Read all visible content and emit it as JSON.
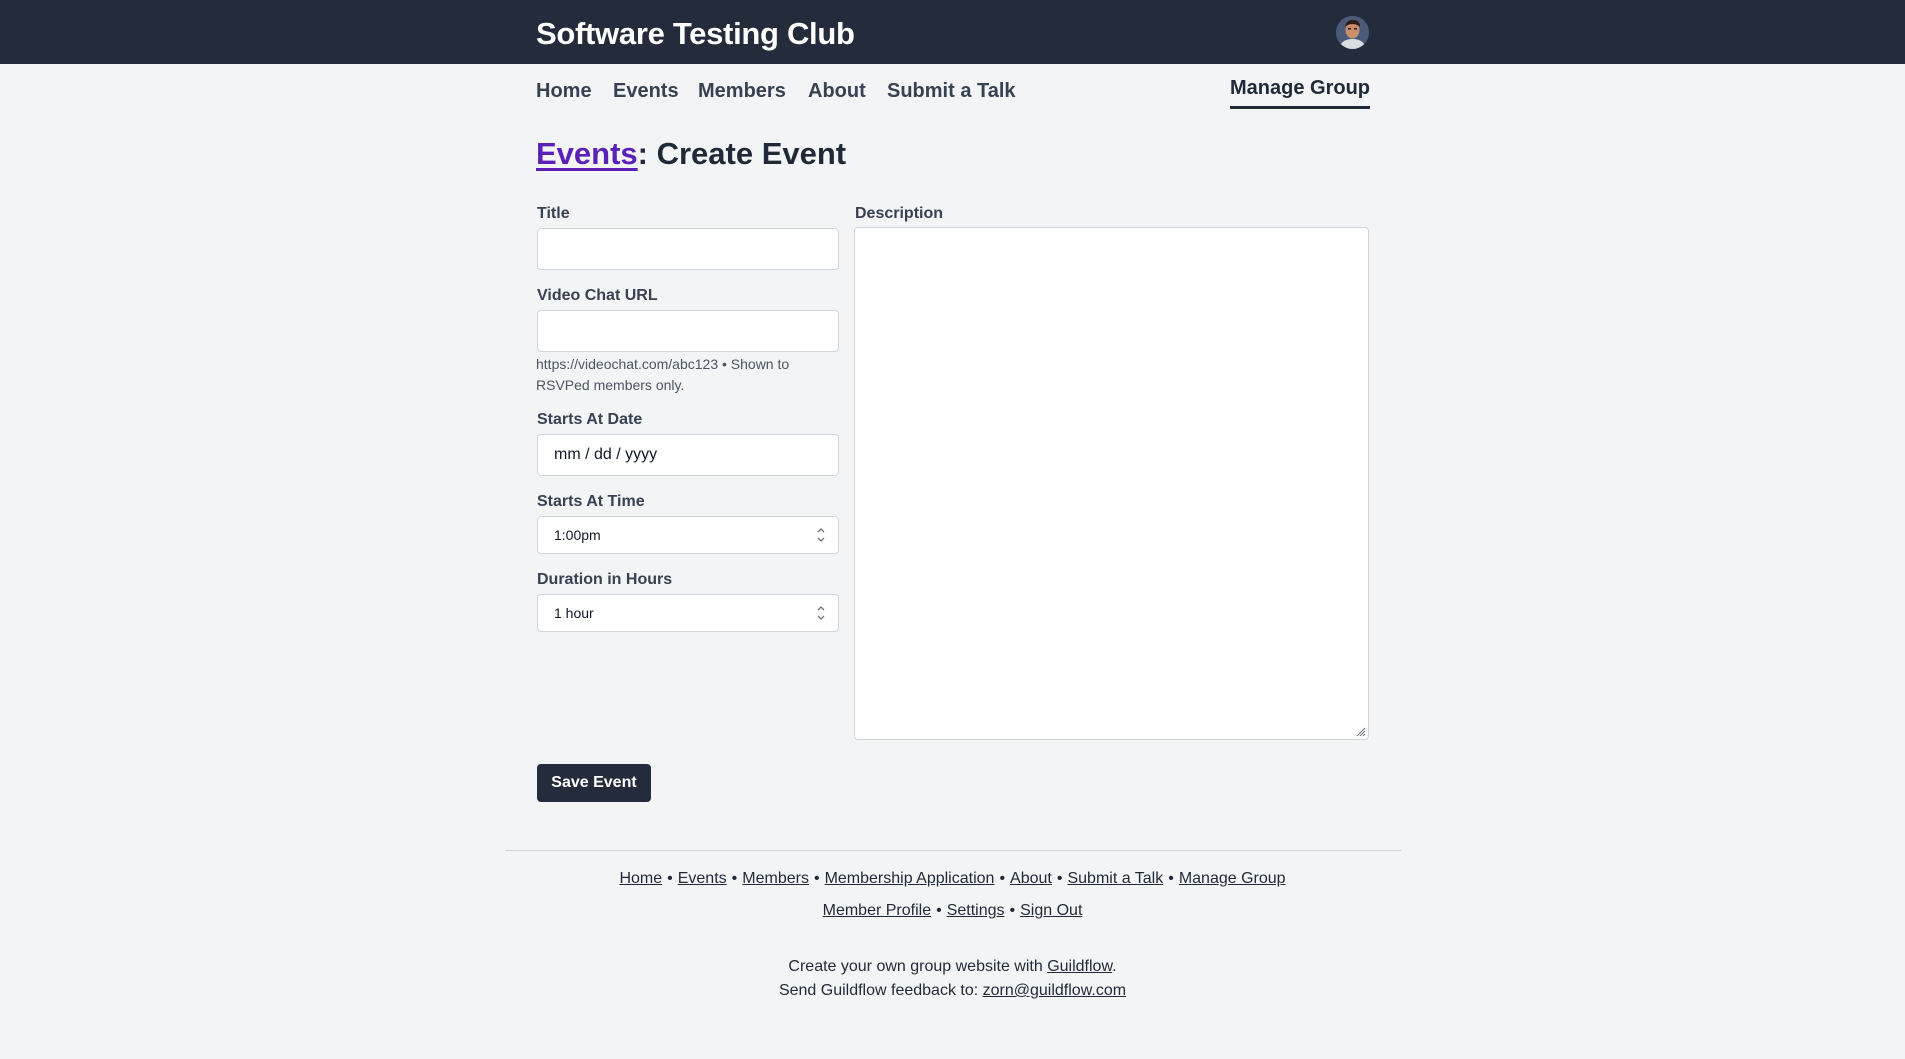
{
  "header": {
    "site_title": "Software Testing Club",
    "avatar_alt": "member avatar"
  },
  "nav": {
    "items": [
      "Home",
      "Events",
      "Members",
      "About",
      "Submit a Talk"
    ],
    "manage_group": "Manage Group"
  },
  "page": {
    "heading_link": "Events",
    "heading_rest": ": Create Event"
  },
  "form": {
    "title_label": "Title",
    "title_value": "",
    "video_label": "Video Chat URL",
    "video_value": "",
    "video_help": "https://videochat.com/abc123 • Shown to RSVPed members only.",
    "date_label": "Starts At Date",
    "date_placeholder": "mm / dd / yyyy",
    "time_label": "Starts At Time",
    "time_value": "1:00pm",
    "duration_label": "Duration in Hours",
    "duration_value": "1 hour",
    "description_label": "Description",
    "description_value": "",
    "save_label": "Save Event"
  },
  "footer": {
    "row1": [
      "Home",
      "Events",
      "Members",
      "Membership Application",
      "About",
      "Submit a Talk",
      "Manage Group"
    ],
    "row2": [
      "Member Profile",
      "Settings",
      "Sign Out"
    ],
    "credit_prefix": "Create your own group website with ",
    "credit_link": "Guildflow",
    "credit_suffix": ".",
    "feedback_prefix": "Send Guildflow feedback to: ",
    "feedback_email": "zorn@guildflow.com"
  },
  "colors": {
    "topbar": "#242c3c",
    "background": "#f3f4f6",
    "link_accent": "#5b21b6"
  }
}
